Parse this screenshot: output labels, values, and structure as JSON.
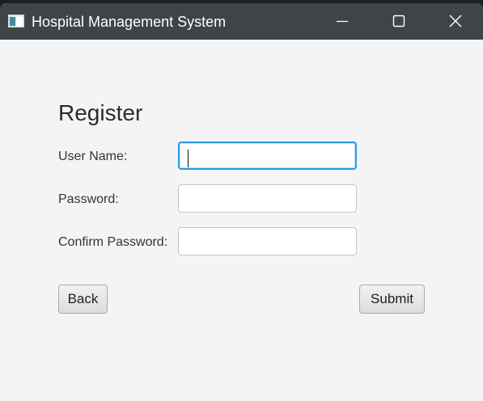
{
  "window": {
    "title": "Hospital Management System",
    "icon": "app-window-icon",
    "controls": {
      "minimize_icon": "minimize-icon",
      "maximize_icon": "maximize-icon",
      "close_icon": "close-icon"
    }
  },
  "form": {
    "heading": "Register",
    "fields": [
      {
        "label": "User Name:",
        "value": "",
        "placeholder": ""
      },
      {
        "label": "Password:",
        "value": "",
        "placeholder": ""
      },
      {
        "label": "Confirm Password:",
        "value": "",
        "placeholder": ""
      }
    ],
    "back_label": "Back",
    "submit_label": "Submit"
  },
  "colors": {
    "titlebar": "#3f4448",
    "background": "#f4f4f4",
    "focus_accent": "#2a9be0"
  }
}
